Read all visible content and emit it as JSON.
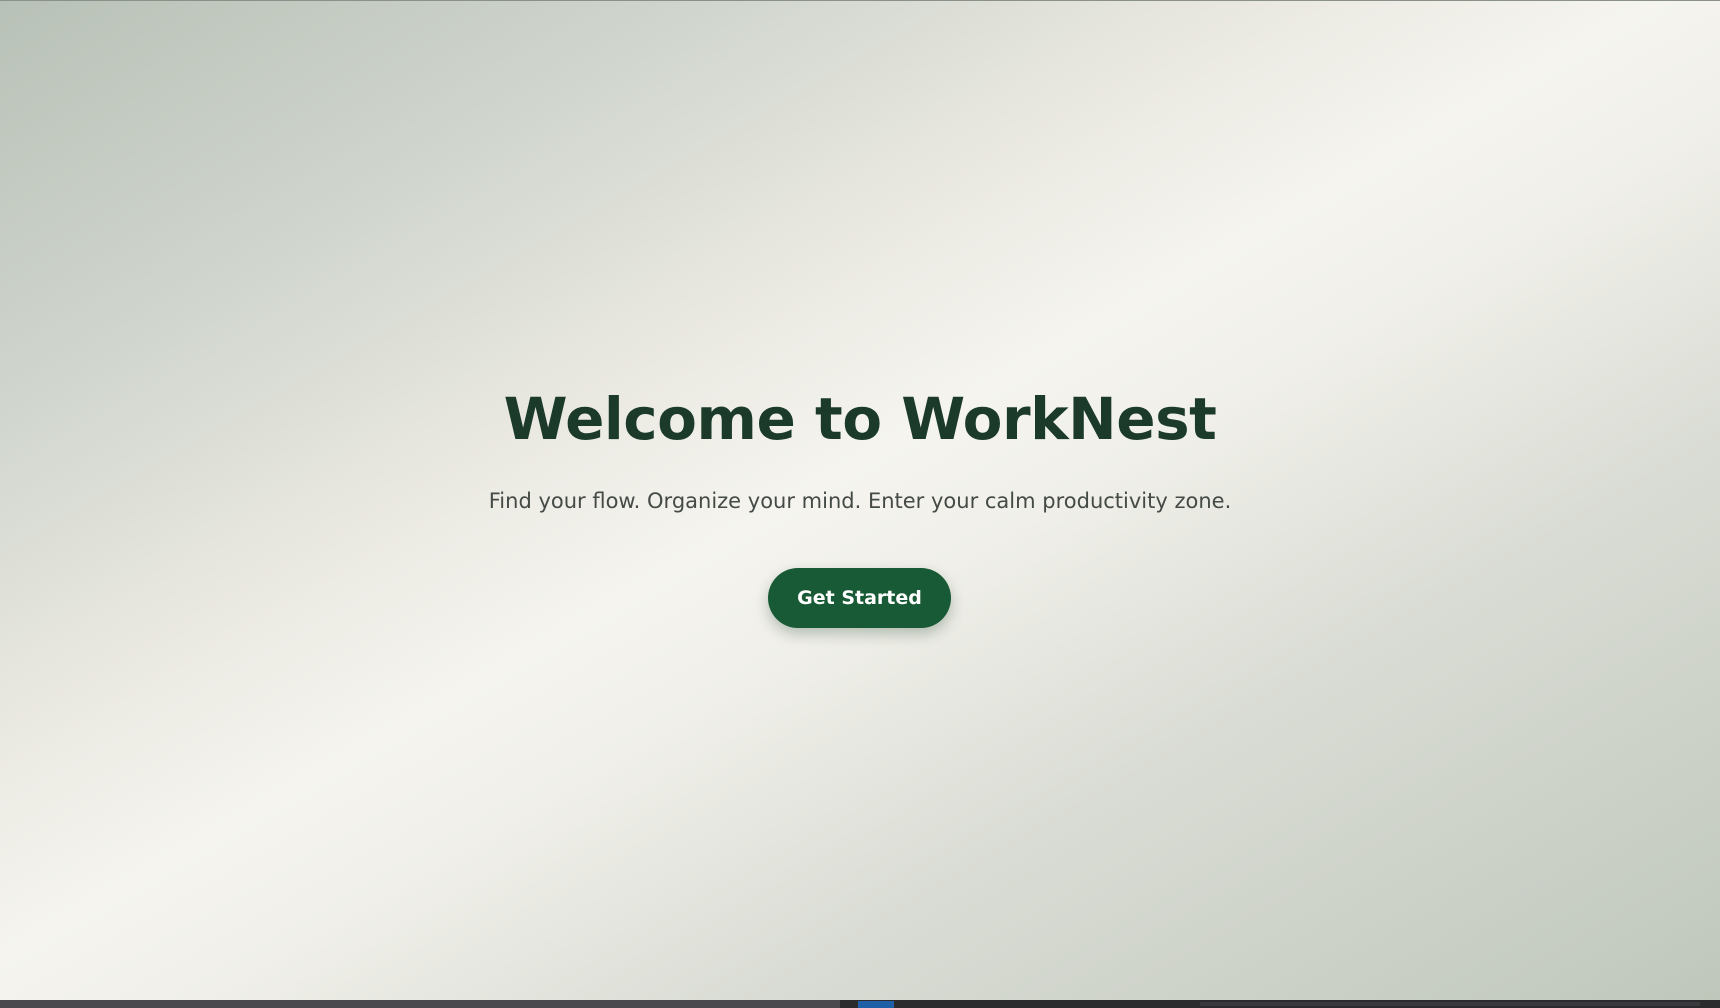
{
  "hero": {
    "title": "Welcome to WorkNest",
    "subtitle": "Find your flow. Organize your mind. Enter your calm productivity zone.",
    "cta_label": "Get Started"
  },
  "colors": {
    "title": "#1b3a2a",
    "subtitle": "#444a46",
    "button_background": "#185a35",
    "button_text": "#ffffff"
  }
}
